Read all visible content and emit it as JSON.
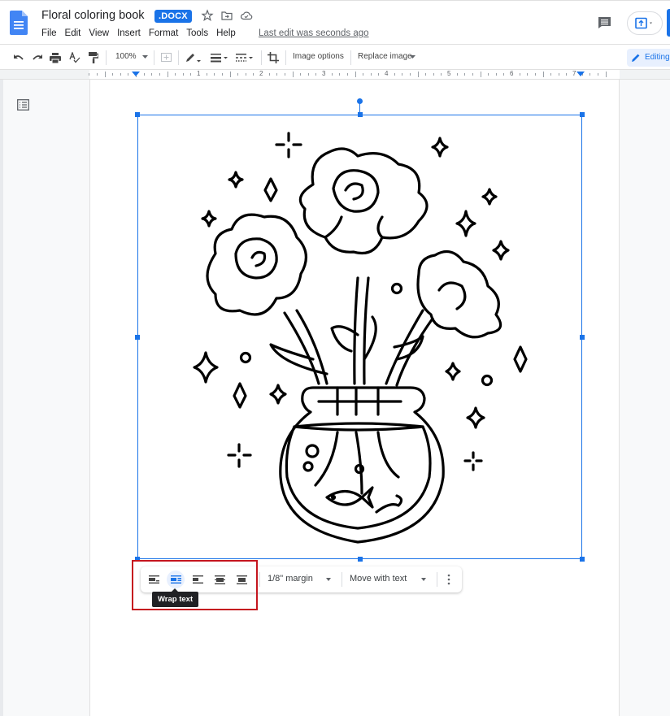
{
  "header": {
    "doc_title": "Floral coloring book",
    "file_badge": ".DOCX",
    "menu": [
      "File",
      "Edit",
      "View",
      "Insert",
      "Format",
      "Tools",
      "Help"
    ],
    "last_edit": "Last edit was seconds ago",
    "icons": [
      "star-icon",
      "move-to-folder-icon",
      "cloud-saved-icon",
      "comment-icon",
      "share-upload-icon"
    ]
  },
  "toolbar": {
    "zoom": "100%",
    "image_options": "Image options",
    "replace_image": "Replace image",
    "mode": "Editing"
  },
  "ruler": {
    "numbers": [
      "1",
      "2",
      "3",
      "4",
      "5",
      "6",
      "7"
    ]
  },
  "image_toolbar": {
    "wrap_options": [
      {
        "name": "in-line",
        "active": false
      },
      {
        "name": "wrap-text",
        "active": true
      },
      {
        "name": "break-text",
        "active": false
      },
      {
        "name": "behind-text",
        "active": false
      },
      {
        "name": "in-front-of-text",
        "active": false
      }
    ],
    "margin": "1/8\" margin",
    "position": "Move with text",
    "tooltip": "Wrap text"
  },
  "colors": {
    "accent": "#1a73e8",
    "highlight_box": "#c5161f"
  }
}
